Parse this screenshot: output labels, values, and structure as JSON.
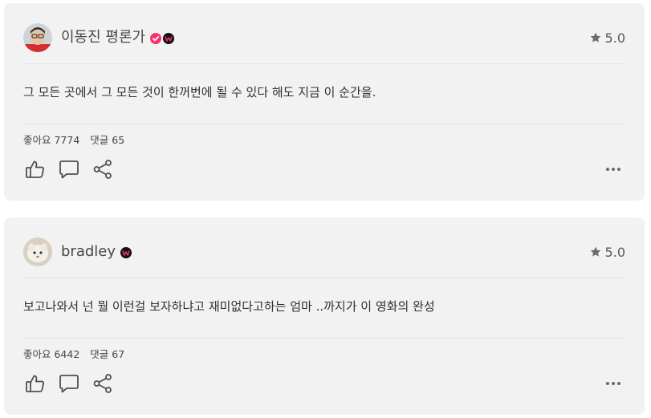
{
  "reviews": [
    {
      "username": "이동진 평론가",
      "verified": true,
      "rating": "5.0",
      "comment": "그 모든 곳에서 그 모든 것이 한꺼번에 될 수 있다 해도 지금 이 순간을.",
      "likes_label": "좋아요 7774",
      "replies_label": "댓글 65"
    },
    {
      "username": "bradley",
      "verified": false,
      "rating": "5.0",
      "comment": "보고나와서 넌 뭘 이런걸 보자하냐고 재미없다고하는 엄마 ..까지가 이 영화의 완성",
      "likes_label": "좋아요 6442",
      "replies_label": "댓글 67"
    }
  ],
  "colors": {
    "card_bg": "#f2f2f3",
    "badge_pink": "#ff2f6e",
    "icon_gray": "#505050"
  },
  "icons": [
    "star-icon",
    "verified-check-icon",
    "watcha-badge-icon",
    "thumbs-up-icon",
    "comment-bubble-icon",
    "share-icon",
    "more-dots-icon"
  ]
}
